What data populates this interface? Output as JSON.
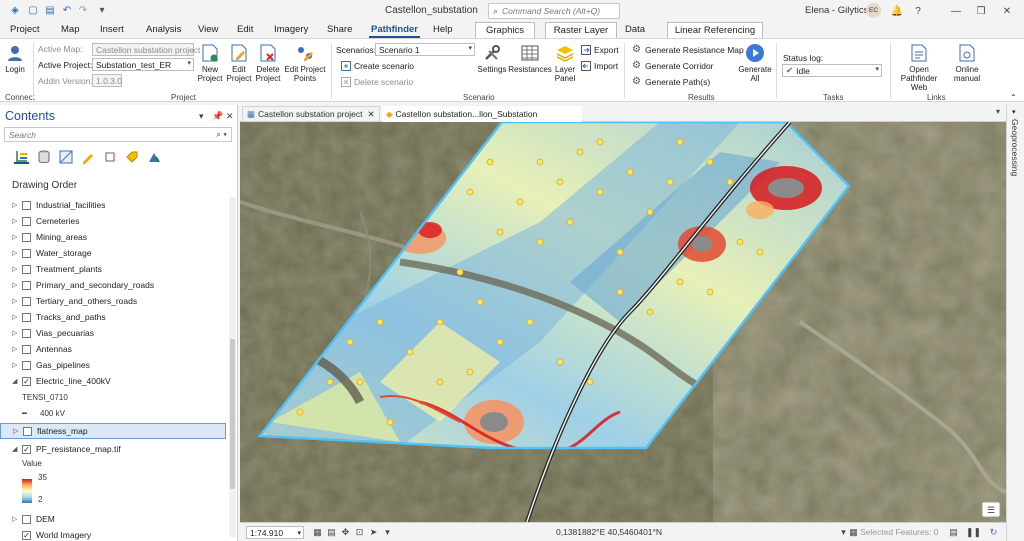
{
  "window": {
    "title": "Castellon_substation",
    "search_placeholder": "Command Search (Alt+Q)",
    "user": "Elena - Gilytics",
    "avatar_initials": "EC"
  },
  "tabs": {
    "project": "Project",
    "map": "Map",
    "insert": "Insert",
    "analysis": "Analysis",
    "view": "View",
    "edit": "Edit",
    "imagery": "Imagery",
    "share": "Share",
    "pathfinder": "Pathfinder",
    "help": "Help",
    "graphics": "Graphics",
    "raster_layer": "Raster Layer",
    "data": "Data",
    "linear_referencing": "Linear Referencing"
  },
  "ribbon": {
    "connect": {
      "label": "Connect",
      "login": "Login"
    },
    "project": {
      "label": "Project",
      "active_map_label": "Active Map:",
      "active_map_value": "Castellon substation project",
      "active_project_label": "Active Project:",
      "active_project_value": "Substation_test_ER",
      "addin_label": "Addin Version:",
      "addin_value": "1.0.3.0",
      "new_project": "New Project",
      "edit_project": "Edit Project",
      "delete_project": "Delete Project",
      "edit_project_points": "Edit Project Points"
    },
    "scenario": {
      "label": "Scenario",
      "scenarios_label": "Scenarios:",
      "scenario_value": "Scenario 1",
      "create": "Create scenario",
      "delete": "Delete scenario",
      "settings": "Settings",
      "resistances": "Resistances",
      "layer_panel": "Layer Panel",
      "export": "Export",
      "import": "Import"
    },
    "results": {
      "label": "Results",
      "gen_resistance_map": "Generate Resistance Map",
      "gen_corridor": "Generate Corridor",
      "gen_paths": "Generate Path(s)",
      "generate_all": "Generate All"
    },
    "tasks": {
      "label": "Tasks",
      "status_log_label": "Status log:",
      "status_value": "Idle"
    },
    "links": {
      "label": "Links",
      "open_web": "Open Pathfinder Web",
      "online_manual": "Online manual"
    }
  },
  "contents": {
    "title": "Contents",
    "search_placeholder": "Search",
    "drawing_order": "Drawing Order",
    "layers": [
      "Industrial_facilities",
      "Cemeteries",
      "Mining_areas",
      "Water_storage",
      "Treatment_plants",
      "Primary_and_secondary_roads",
      "Tertiary_and_others_roads",
      "Tracks_and_paths",
      "Vias_pecuarias",
      "Antennas",
      "Gas_pipelines",
      "Electric_line_400kV"
    ],
    "electric_sub_field": "TENSI_0710",
    "electric_sub_value": "400 kV",
    "flatness": "flatness_map",
    "pf_resistance": "PF_resistance_map.tif",
    "legend_title": "Value",
    "legend_max": "35",
    "legend_min": "2",
    "dem": "DEM",
    "world_imagery": "World Imagery"
  },
  "map": {
    "tab1": "Castellon substation project",
    "tab2": "Castellon substation...llon_Substation",
    "scale": "1:74.910",
    "coords": "0,1381882°E 40,5460401°N",
    "selected_features": "Selected Features: 0",
    "geoprocessing": "Geoprocessing"
  },
  "colors": {
    "accent": "#1f4e9c",
    "resistance_high": "#d7191c",
    "resistance_mid": "#ffffbf",
    "resistance_low": "#2c7bb6",
    "aoi_border": "#4fc3f7",
    "status_ok": "#2e8b57"
  }
}
